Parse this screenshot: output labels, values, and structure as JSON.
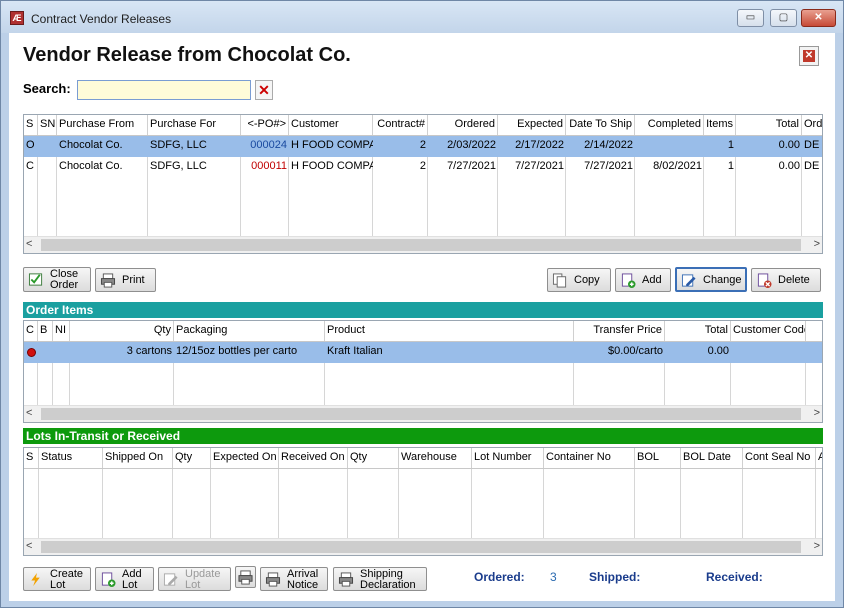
{
  "window": {
    "title": "Contract Vendor Releases",
    "min": "▭",
    "max": "▢",
    "close": "✕"
  },
  "page": {
    "title": "Vendor Release from Chocolat Co."
  },
  "search": {
    "label": "Search:",
    "value": ""
  },
  "releases": {
    "headers": [
      "S",
      "SN",
      "Purchase From",
      "Purchase For",
      "<-PO#>",
      "Customer",
      "Contract#",
      "Ordered",
      "Expected",
      "Date To Ship",
      "Completed",
      "Items",
      "Total",
      "Ord"
    ],
    "rows": [
      [
        "O",
        "",
        "Chocolat Co.",
        "SDFG, LLC",
        "000024",
        "H FOOD COMPA",
        "2",
        "2/03/2022",
        "2/17/2022",
        "2/14/2022",
        "",
        "1",
        "0.00",
        "DE"
      ],
      [
        "C",
        "",
        "Chocolat Co.",
        "SDFG, LLC",
        "000011",
        "H FOOD COMPA",
        "2",
        "7/27/2021",
        "7/27/2021",
        "7/27/2021",
        "8/02/2021",
        "1",
        "0.00",
        "DE"
      ]
    ]
  },
  "actions": {
    "close_order": "Close Order",
    "print": "Print",
    "copy": "Copy",
    "add": "Add",
    "change": "Change",
    "delete": "Delete"
  },
  "order_items": {
    "section": "Order Items",
    "headers": [
      "C",
      "B",
      "NI",
      "Qty",
      "Packaging",
      "Product",
      "Transfer Price",
      "Total",
      "Customer Code"
    ],
    "rows": [
      [
        "",
        "",
        "",
        "3  cartons",
        "12/15oz bottles per carto",
        "Kraft Italian",
        "$0.00/carto",
        "0.00",
        ""
      ]
    ]
  },
  "lots": {
    "section": "Lots In-Transit or Received",
    "headers": [
      "S",
      "Status",
      "Shipped On",
      "Qty",
      "Expected On",
      "Received On",
      "Qty",
      "Warehouse",
      "Lot Number",
      "Container No",
      "BOL",
      "BOL Date",
      "Cont Seal No",
      "A"
    ]
  },
  "footer": {
    "create_lot": "Create Lot",
    "add_lot": "Add Lot",
    "update_lot": "Update Lot",
    "arrival_notice": "Arrival Notice",
    "shipping_declaration": "Shipping Declaration",
    "ordered_label": "Ordered:",
    "ordered_value": "3",
    "shipped_label": "Shipped:",
    "received_label": "Received:"
  },
  "colors": {
    "selected_row": "#99bde9",
    "order_items_bar": "#1aa0a0",
    "lots_bar": "#0d9a0d",
    "po_red": "#c00000",
    "po_blue": "#1a4aa0"
  }
}
